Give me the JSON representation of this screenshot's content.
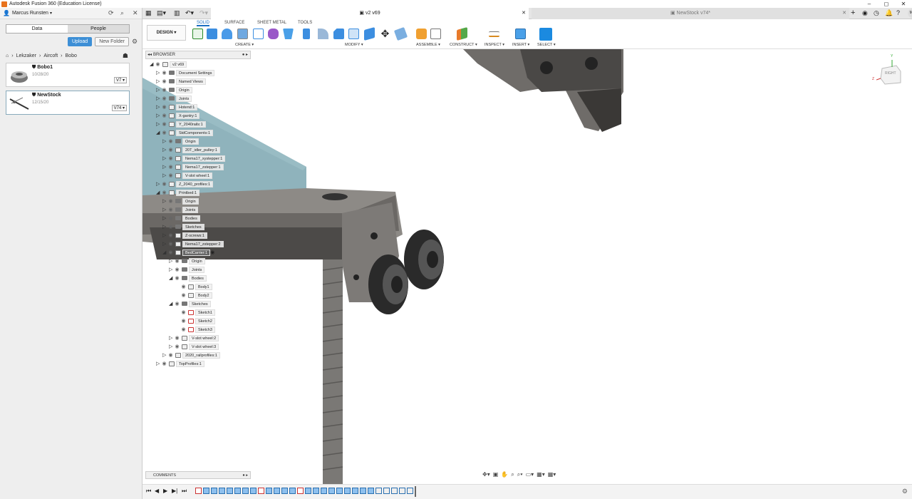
{
  "window": {
    "title": "Autodesk Fusion 360 (Education License)",
    "min": "–",
    "max": "◻",
    "close": "✕"
  },
  "datapanel": {
    "user": "Marcus Runsten",
    "tabs": [
      "Data",
      "People"
    ],
    "upload": "Upload",
    "new_folder": "New Folder",
    "breadcrumb": [
      "Lekzaker",
      "Aircoft",
      "Bobo"
    ],
    "files": [
      {
        "name": "Bobo1",
        "date": "10/28/20",
        "version": "V7 ▾"
      },
      {
        "name": "NewStock",
        "date": "12/15/20",
        "version": "V74 ▾"
      }
    ]
  },
  "doctabs": {
    "active": "v2 v69",
    "inactive": "NewStock v74*",
    "avatar": "MR"
  },
  "toolbar": {
    "workspaces": [
      "SOLID",
      "SURFACE",
      "SHEET METAL",
      "TOOLS"
    ],
    "design": "DESIGN ▾",
    "groups": [
      "CREATE ▾",
      "MODIFY ▾",
      "ASSEMBLE ▾",
      "CONSTRUCT ▾",
      "INSPECT ▾",
      "INSERT ▾",
      "SELECT ▾"
    ]
  },
  "browser": {
    "title": "BROWSER",
    "nodes": [
      {
        "label": "v2 v69",
        "depth": 0,
        "arrow": "◢",
        "kind": "doc"
      },
      {
        "label": "Document Settings",
        "depth": 1,
        "arrow": "▷",
        "kind": "gear"
      },
      {
        "label": "Named Views",
        "depth": 1,
        "arrow": "▷",
        "kind": "folder"
      },
      {
        "label": "Origin",
        "depth": 1,
        "arrow": "▷",
        "kind": "folder"
      },
      {
        "label": "Joints",
        "depth": 1,
        "arrow": "▷",
        "kind": "folder"
      },
      {
        "label": "Hotend:1",
        "depth": 1,
        "arrow": "▷",
        "kind": "comp"
      },
      {
        "label": "X-gantry:1",
        "depth": 1,
        "arrow": "▷",
        "kind": "comp"
      },
      {
        "label": "Y_2040rails:1",
        "depth": 1,
        "arrow": "▷",
        "kind": "comp"
      },
      {
        "label": "StdComponents:1",
        "depth": 1,
        "arrow": "◢",
        "kind": "comp"
      },
      {
        "label": "Origin",
        "depth": 2,
        "arrow": "▷",
        "kind": "folder"
      },
      {
        "label": "20T_idler_pulley:1",
        "depth": 2,
        "arrow": "▷",
        "kind": "comp"
      },
      {
        "label": "Nema17_xystepper:1",
        "depth": 2,
        "arrow": "▷",
        "kind": "comp"
      },
      {
        "label": "Nema17_zstepper:1",
        "depth": 2,
        "arrow": "▷",
        "kind": "comp"
      },
      {
        "label": "V-slot wheel:1",
        "depth": 2,
        "arrow": "▷",
        "kind": "comp"
      },
      {
        "label": "Z_2040_profiles:1",
        "depth": 1,
        "arrow": "▷",
        "kind": "comp"
      },
      {
        "label": "Printbed:1",
        "depth": 1,
        "arrow": "◢",
        "kind": "comp"
      },
      {
        "label": "Origin",
        "depth": 2,
        "arrow": "▷",
        "kind": "folder"
      },
      {
        "label": "Joints",
        "depth": 2,
        "arrow": "▷",
        "kind": "folder"
      },
      {
        "label": "Bodies",
        "depth": 2,
        "arrow": "▷",
        "kind": "folder"
      },
      {
        "label": "Sketches",
        "depth": 2,
        "arrow": "▷",
        "kind": "folder"
      },
      {
        "label": "Z-screws:1",
        "depth": 2,
        "arrow": "▷",
        "kind": "comp"
      },
      {
        "label": "Nema17_zstepper:2",
        "depth": 2,
        "arrow": "▷",
        "kind": "comp"
      },
      {
        "label": "BedCarrier:1",
        "depth": 2,
        "arrow": "◢",
        "kind": "comp",
        "selected": true
      },
      {
        "label": "Origin",
        "depth": 3,
        "arrow": "▷",
        "kind": "folder"
      },
      {
        "label": "Joints",
        "depth": 3,
        "arrow": "▷",
        "kind": "folder"
      },
      {
        "label": "Bodies",
        "depth": 3,
        "arrow": "◢",
        "kind": "folder"
      },
      {
        "label": "Body1",
        "depth": 4,
        "arrow": "",
        "kind": "body"
      },
      {
        "label": "Body2",
        "depth": 4,
        "arrow": "",
        "kind": "body"
      },
      {
        "label": "Sketches",
        "depth": 3,
        "arrow": "◢",
        "kind": "folder"
      },
      {
        "label": "Sketch1",
        "depth": 4,
        "arrow": "",
        "kind": "sketch"
      },
      {
        "label": "Sketch2",
        "depth": 4,
        "arrow": "",
        "kind": "sketch"
      },
      {
        "label": "Sketch3",
        "depth": 4,
        "arrow": "",
        "kind": "sketch"
      },
      {
        "label": "V-slot wheel:2",
        "depth": 3,
        "arrow": "▷",
        "kind": "comp"
      },
      {
        "label": "V-slot wheel:3",
        "depth": 3,
        "arrow": "▷",
        "kind": "comp"
      },
      {
        "label": "2020_railprofiles:1",
        "depth": 2,
        "arrow": "▷",
        "kind": "comp"
      },
      {
        "label": "TopProfiles:1",
        "depth": 1,
        "arrow": "▷",
        "kind": "comp"
      }
    ]
  },
  "comments": {
    "title": "COMMENTS"
  },
  "viewcube": {
    "label": "RIGHT",
    "axis_z": "Z",
    "axis_y": "Y"
  },
  "colors": {
    "accent": "#1b6fc2",
    "upload": "#3d8fd6",
    "glass": "#6a9aa6",
    "part": "#8d8a86"
  }
}
